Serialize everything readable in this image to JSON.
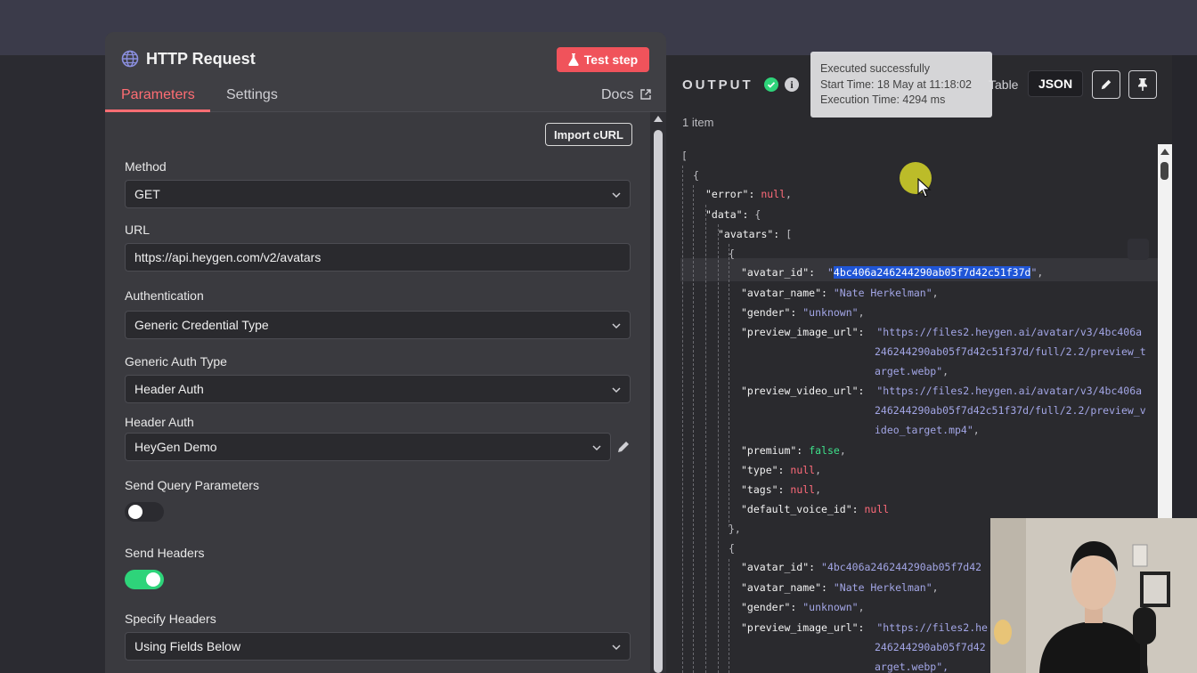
{
  "node": {
    "title": "HTTP Request",
    "test_step_label": "Test step",
    "tabs": [
      {
        "label": "Parameters",
        "active": true
      },
      {
        "label": "Settings",
        "active": false
      }
    ],
    "docs_label": "Docs",
    "import_curl_label": "Import cURL",
    "fields": {
      "method": {
        "label": "Method",
        "value": "GET"
      },
      "url": {
        "label": "URL",
        "value": "https://api.heygen.com/v2/avatars"
      },
      "authentication": {
        "label": "Authentication",
        "value": "Generic Credential Type"
      },
      "generic_auth_type": {
        "label": "Generic Auth Type",
        "value": "Header Auth"
      },
      "header_auth": {
        "label": "Header Auth",
        "value": "HeyGen Demo"
      },
      "send_query_parameters": {
        "label": "Send Query Parameters",
        "enabled": false
      },
      "send_headers": {
        "label": "Send Headers",
        "enabled": true
      },
      "specify_headers": {
        "label": "Specify Headers",
        "value": "Using Fields Below"
      }
    }
  },
  "output": {
    "title": "OUTPUT",
    "table_label": "Table",
    "json_label": "JSON",
    "item_count": "1 item",
    "tooltip": {
      "line1": "Executed successfully",
      "line2": "Start Time: 18 May at 11:18:02",
      "line3": "Execution Time: 4294 ms"
    },
    "json": {
      "open_bracket": "[",
      "open_brace": "{",
      "error_key": "\"error\":",
      "error_val": "null",
      "data_key": "\"data\":",
      "data_open": "{",
      "avatars_key": "\"avatars\":",
      "avatars_open": "[",
      "item1_open": "{",
      "avatar_id_key": "\"avatar_id\":",
      "avatar_id_val": "\"4bc406a246244290ab05f7d42c51f37d\"",
      "avatar_name_key": "\"avatar_name\":",
      "avatar_name_val": "\"Nate Herkelman\"",
      "gender_key": "\"gender\":",
      "gender_val": "\"unknown\"",
      "preview_image_key": "\"preview_image_url\":",
      "preview_image_val_1": "\"https://files2.heygen.ai/avatar/v3/4bc406a",
      "preview_image_val_2": "246244290ab05f7d42c51f37d/full/2.2/preview_t",
      "preview_image_val_3": "arget.webp\"",
      "preview_video_key": "\"preview_video_url\":",
      "preview_video_val_1": "\"https://files2.heygen.ai/avatar/v3/4bc406a",
      "preview_video_val_2": "246244290ab05f7d42c51f37d/full/2.2/preview_v",
      "preview_video_val_3": "ideo_target.mp4\"",
      "premium_key": "\"premium\":",
      "premium_val": "false",
      "type_key": "\"type\":",
      "type_val": "null",
      "tags_key": "\"tags\":",
      "tags_val": "null",
      "default_voice_key": "\"default_voice_id\":",
      "default_voice_val": "null",
      "item1_close": "},",
      "item2_open": "{",
      "avatar_id_val_2": "\"4bc406a246244290ab05f7d42",
      "preview_image_val2_1": "\"https://files2.he",
      "preview_image_val2_2": "246244290ab05f7d42",
      "preview_image_val2_3": "arget.webp\","
    }
  },
  "colors": {
    "accent": "#ff6d73",
    "toggle_on": "#2ed47a",
    "json_string": "#a3a6e6",
    "json_null": "#ff6b7a",
    "json_bool": "#3ee08a"
  }
}
